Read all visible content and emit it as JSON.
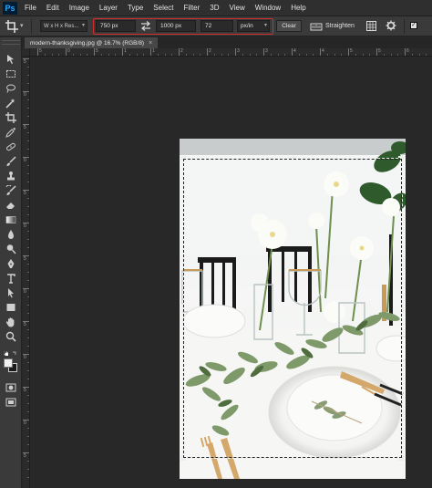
{
  "app": {
    "logo_text": "Ps",
    "accent": "#31a8ff"
  },
  "menu": [
    "File",
    "Edit",
    "Image",
    "Layer",
    "Type",
    "Select",
    "Filter",
    "3D",
    "View",
    "Window",
    "Help"
  ],
  "options_bar": {
    "tool_icon": "crop-icon",
    "ratio_preset": "W x H x Res...",
    "width_value": "750 px",
    "height_value": "1000 px",
    "resolution_value": "72",
    "resolution_unit": "px/in",
    "clear_label": "Clear",
    "straighten_label": "Straighten",
    "delete_cropped_checked": true,
    "highlight_color": "#d42b2b"
  },
  "document": {
    "tab_title": "modern-thanksgiving.jpg @ 16.7% (RGB/8)",
    "close_symbol": "×"
  },
  "ruler_h_labels": [
    "5",
    "0",
    "5",
    "1",
    "1",
    "2",
    "2",
    "3",
    "3",
    "4",
    "4",
    "5",
    "5",
    "6"
  ],
  "ruler_v_labels": [
    "5",
    "0",
    "5",
    "0",
    "5",
    "0",
    "5",
    "0",
    "5",
    "0",
    "5",
    "0",
    "5"
  ],
  "tools": [
    "move-icon",
    "marquee-icon",
    "lasso-icon",
    "quick-select-icon",
    "crop-icon",
    "eyedropper-icon",
    "healing-brush-icon",
    "brush-icon",
    "clone-stamp-icon",
    "history-brush-icon",
    "eraser-icon",
    "gradient-icon",
    "blur-icon",
    "dodge-icon",
    "pen-icon",
    "type-icon",
    "path-select-icon",
    "shape-icon",
    "hand-icon",
    "zoom-icon",
    "foreground-background-colors-icon",
    "quick-mask-icon",
    "screen-mode-icon"
  ]
}
